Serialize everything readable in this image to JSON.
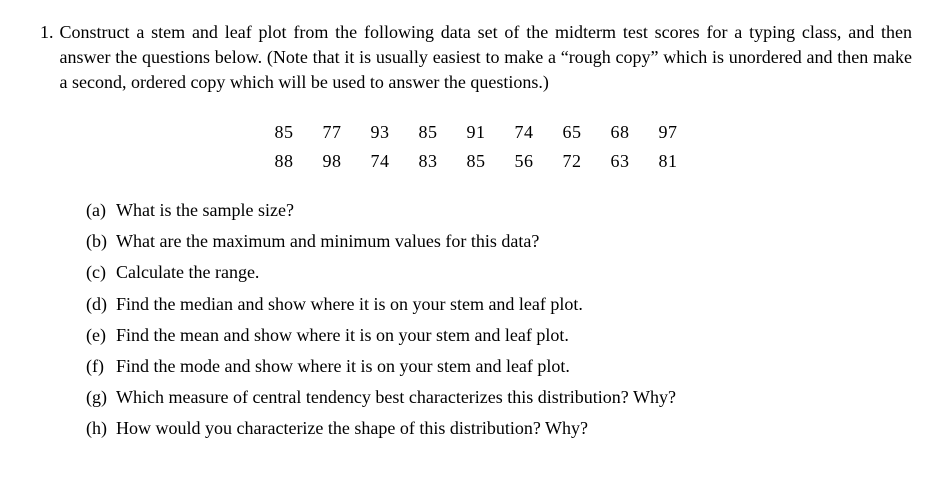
{
  "problem": {
    "number": "1.",
    "text": "Construct a stem and leaf plot from the following data set of the midterm test scores for a typing class, and then answer the questions below. (Note that it is usually easiest to make a “rough copy” which is unordered and then make a second, ordered copy which will be used to answer the questions.)"
  },
  "dataset": {
    "row1": [
      "85",
      "77",
      "93",
      "85",
      "91",
      "74",
      "65",
      "68",
      "97"
    ],
    "row2": [
      "88",
      "98",
      "74",
      "83",
      "85",
      "56",
      "72",
      "63",
      "81"
    ]
  },
  "subparts": [
    {
      "label": "(a)",
      "text": "What is the sample size?"
    },
    {
      "label": "(b)",
      "text": "What are the maximum and minimum values for this data?"
    },
    {
      "label": "(c)",
      "text": "Calculate the range."
    },
    {
      "label": "(d)",
      "text": "Find the median and show where it is on your stem and leaf plot."
    },
    {
      "label": "(e)",
      "text": "Find the mean and show where it is on your stem and leaf plot."
    },
    {
      "label": "(f)",
      "text": "Find the mode and show where it is on your stem and leaf plot."
    },
    {
      "label": "(g)",
      "text": "Which measure of central tendency best characterizes this distribution? Why?"
    },
    {
      "label": "(h)",
      "text": "How would you characterize the shape of this distribution? Why?"
    }
  ]
}
